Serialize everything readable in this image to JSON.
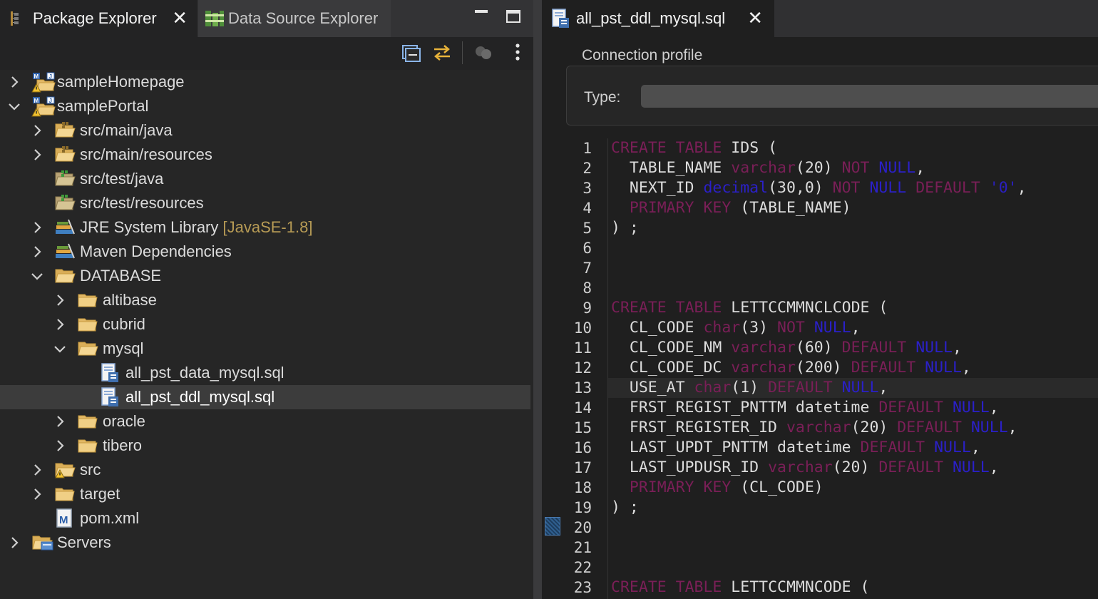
{
  "left_view": {
    "tabs": [
      {
        "label": "Package Explorer",
        "active": true
      },
      {
        "label": "Data Source Explorer",
        "active": false
      }
    ],
    "close_glyph": "✕"
  },
  "tree": [
    {
      "indent": 0,
      "twisty": "right",
      "icon": "maven-project-warning-icon",
      "label": "sampleHomepage",
      "decor": ""
    },
    {
      "indent": 0,
      "twisty": "down",
      "icon": "maven-project-warning-icon",
      "label": "samplePortal",
      "decor": ""
    },
    {
      "indent": 1,
      "twisty": "right",
      "icon": "source-folder-icon",
      "label": "src/main/java",
      "decor": ""
    },
    {
      "indent": 1,
      "twisty": "right",
      "icon": "source-folder-icon",
      "label": "src/main/resources",
      "decor": ""
    },
    {
      "indent": 1,
      "twisty": "",
      "icon": "test-source-folder-icon",
      "label": "src/test/java",
      "decor": ""
    },
    {
      "indent": 1,
      "twisty": "",
      "icon": "test-source-folder-icon",
      "label": "src/test/resources",
      "decor": ""
    },
    {
      "indent": 1,
      "twisty": "right",
      "icon": "library-icon",
      "label": "JRE System Library",
      "decor": "[JavaSE-1.8]"
    },
    {
      "indent": 1,
      "twisty": "right",
      "icon": "library-icon",
      "label": "Maven Dependencies",
      "decor": ""
    },
    {
      "indent": 1,
      "twisty": "down",
      "icon": "folder-open-icon",
      "label": "DATABASE",
      "decor": ""
    },
    {
      "indent": 2,
      "twisty": "right",
      "icon": "folder-icon",
      "label": "altibase",
      "decor": ""
    },
    {
      "indent": 2,
      "twisty": "right",
      "icon": "folder-icon",
      "label": "cubrid",
      "decor": ""
    },
    {
      "indent": 2,
      "twisty": "down",
      "icon": "folder-open-icon",
      "label": "mysql",
      "decor": ""
    },
    {
      "indent": 3,
      "twisty": "",
      "icon": "sql-file-icon",
      "label": "all_pst_data_mysql.sql",
      "decor": ""
    },
    {
      "indent": 3,
      "twisty": "",
      "icon": "sql-file-icon",
      "label": "all_pst_ddl_mysql.sql",
      "decor": "",
      "selected": true
    },
    {
      "indent": 2,
      "twisty": "right",
      "icon": "folder-icon",
      "label": "oracle",
      "decor": ""
    },
    {
      "indent": 2,
      "twisty": "right",
      "icon": "folder-icon",
      "label": "tibero",
      "decor": ""
    },
    {
      "indent": 1,
      "twisty": "right",
      "icon": "folder-warning-icon",
      "label": "src",
      "decor": ""
    },
    {
      "indent": 1,
      "twisty": "right",
      "icon": "folder-icon",
      "label": "target",
      "decor": ""
    },
    {
      "indent": 1,
      "twisty": "",
      "icon": "maven-pom-icon",
      "label": "pom.xml",
      "decor": ""
    },
    {
      "indent": 0,
      "twisty": "right",
      "icon": "servers-folder-icon",
      "label": "Servers",
      "decor": ""
    }
  ],
  "editor": {
    "tab_label": "all_pst_ddl_mysql.sql",
    "connection_profile_label": "Connection profile",
    "type_label": "Type:",
    "type_value": "",
    "current_line": 13,
    "lines": [
      [
        [
          "kw",
          "CREATE"
        ],
        [
          "t",
          " "
        ],
        [
          "kw",
          "TABLE"
        ],
        [
          "t",
          " IDS ("
        ]
      ],
      [
        [
          "t",
          "  TABLE_NAME "
        ],
        [
          "kw",
          "varchar"
        ],
        [
          "t",
          "(20) "
        ],
        [
          "kw",
          "NOT"
        ],
        [
          "t",
          " "
        ],
        [
          "nl",
          "NULL"
        ],
        [
          "t",
          ","
        ]
      ],
      [
        [
          "t",
          "  NEXT_ID "
        ],
        [
          "nl",
          "decimal"
        ],
        [
          "t",
          "(30,0) "
        ],
        [
          "kw",
          "NOT"
        ],
        [
          "t",
          " "
        ],
        [
          "nl",
          "NULL"
        ],
        [
          "t",
          " "
        ],
        [
          "kw",
          "DEFAULT"
        ],
        [
          "t",
          " "
        ],
        [
          "str",
          "'0'"
        ],
        [
          "t",
          ","
        ]
      ],
      [
        [
          "t",
          "  "
        ],
        [
          "kw",
          "PRIMARY"
        ],
        [
          "t",
          " "
        ],
        [
          "kw",
          "KEY"
        ],
        [
          "t",
          " (TABLE_NAME)"
        ]
      ],
      [
        [
          "t",
          ") ;"
        ]
      ],
      [
        [
          "t",
          ""
        ]
      ],
      [
        [
          "t",
          ""
        ]
      ],
      [
        [
          "t",
          ""
        ]
      ],
      [
        [
          "kw",
          "CREATE"
        ],
        [
          "t",
          " "
        ],
        [
          "kw",
          "TABLE"
        ],
        [
          "t",
          " LETTCCMMNCLCODE ("
        ]
      ],
      [
        [
          "t",
          "  CL_CODE "
        ],
        [
          "kw",
          "char"
        ],
        [
          "t",
          "(3) "
        ],
        [
          "kw",
          "NOT"
        ],
        [
          "t",
          " "
        ],
        [
          "nl",
          "NULL"
        ],
        [
          "t",
          ","
        ]
      ],
      [
        [
          "t",
          "  CL_CODE_NM "
        ],
        [
          "kw",
          "varchar"
        ],
        [
          "t",
          "(60) "
        ],
        [
          "kw",
          "DEFAULT"
        ],
        [
          "t",
          " "
        ],
        [
          "nl",
          "NULL"
        ],
        [
          "t",
          ","
        ]
      ],
      [
        [
          "t",
          "  CL_CODE_DC "
        ],
        [
          "kw",
          "varchar"
        ],
        [
          "t",
          "(200) "
        ],
        [
          "kw",
          "DEFAULT"
        ],
        [
          "t",
          " "
        ],
        [
          "nl",
          "NULL"
        ],
        [
          "t",
          ","
        ]
      ],
      [
        [
          "t",
          "  USE_AT "
        ],
        [
          "kw",
          "char"
        ],
        [
          "t",
          "(1) "
        ],
        [
          "kw",
          "DEFAULT"
        ],
        [
          "t",
          " "
        ],
        [
          "nl",
          "NULL"
        ],
        [
          "t",
          ","
        ]
      ],
      [
        [
          "t",
          "  FRST_REGIST_PNTTM datetime "
        ],
        [
          "kw",
          "DEFAULT"
        ],
        [
          "t",
          " "
        ],
        [
          "nl",
          "NULL"
        ],
        [
          "t",
          ","
        ]
      ],
      [
        [
          "t",
          "  FRST_REGISTER_ID "
        ],
        [
          "kw",
          "varchar"
        ],
        [
          "t",
          "(20) "
        ],
        [
          "kw",
          "DEFAULT"
        ],
        [
          "t",
          " "
        ],
        [
          "nl",
          "NULL"
        ],
        [
          "t",
          ","
        ]
      ],
      [
        [
          "t",
          "  LAST_UPDT_PNTTM datetime "
        ],
        [
          "kw",
          "DEFAULT"
        ],
        [
          "t",
          " "
        ],
        [
          "nl",
          "NULL"
        ],
        [
          "t",
          ","
        ]
      ],
      [
        [
          "t",
          "  LAST_UPDUSR_ID "
        ],
        [
          "kw",
          "varchar"
        ],
        [
          "t",
          "(20) "
        ],
        [
          "kw",
          "DEFAULT"
        ],
        [
          "t",
          " "
        ],
        [
          "nl",
          "NULL"
        ],
        [
          "t",
          ","
        ]
      ],
      [
        [
          "t",
          "  "
        ],
        [
          "kw",
          "PRIMARY"
        ],
        [
          "t",
          " "
        ],
        [
          "kw",
          "KEY"
        ],
        [
          "t",
          " (CL_CODE)"
        ]
      ],
      [
        [
          "t",
          ") ;"
        ]
      ],
      [
        [
          "t",
          ""
        ]
      ],
      [
        [
          "t",
          ""
        ]
      ],
      [
        [
          "t",
          ""
        ]
      ],
      [
        [
          "kw",
          "CREATE"
        ],
        [
          "t",
          " "
        ],
        [
          "kw",
          "TABLE"
        ],
        [
          "t",
          " LETTCCMMNCODE ("
        ]
      ]
    ]
  }
}
